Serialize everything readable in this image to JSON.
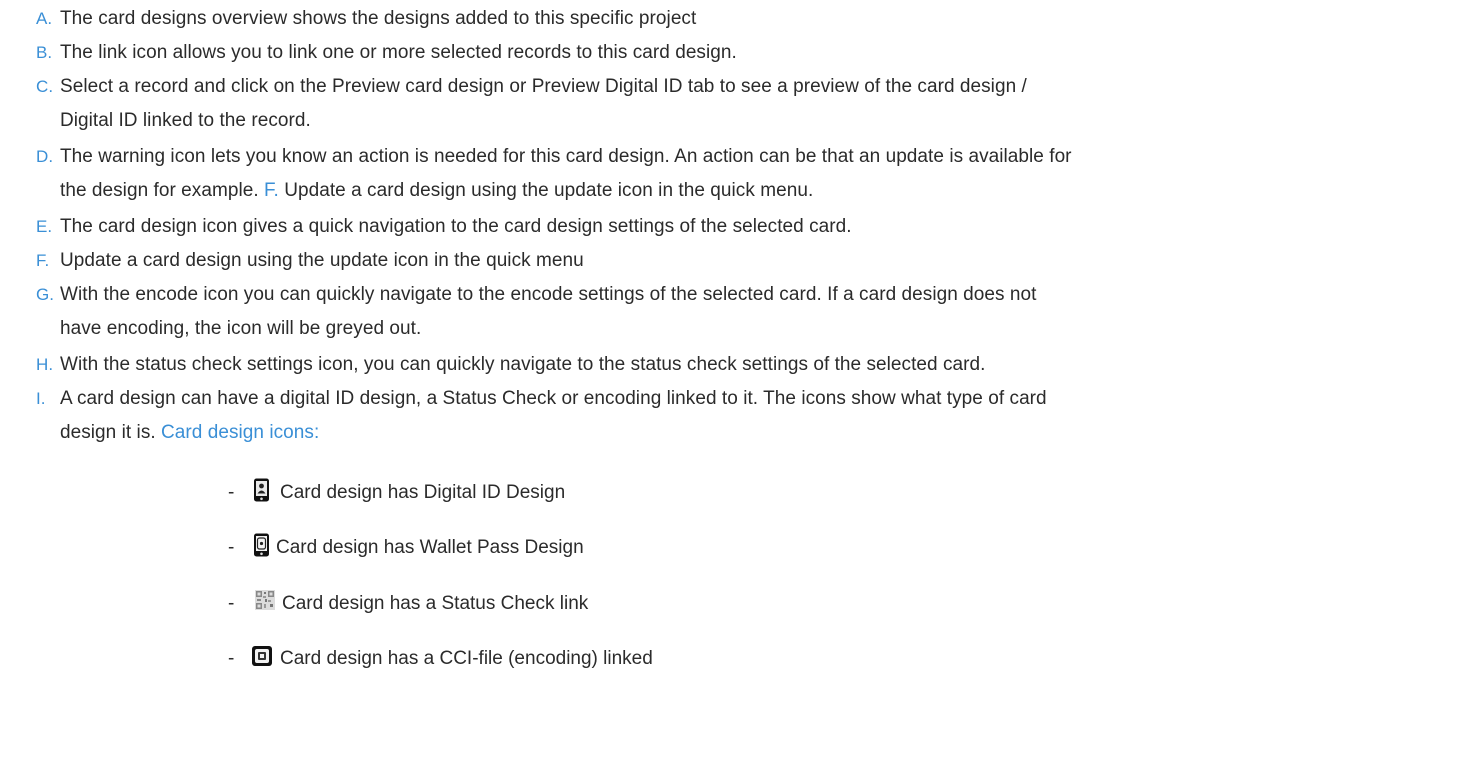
{
  "items": [
    {
      "letter": "A.",
      "text": "The card designs overview shows the designs added to this specific project"
    },
    {
      "letter": "B.",
      "text": "The link icon allows you to link one or more selected records to this card design."
    },
    {
      "letter": "C.",
      "line1": "Select a record and click on the Preview card design or Preview Digital ID tab to see a preview of the card design /",
      "line2": "Digital ID linked to the record."
    },
    {
      "letter": "D.",
      "line1": "The warning icon lets you know an action is needed for this card design. An action can be that an update is available for",
      "line2_pre": "the design for example. ",
      "line2_accent": "F.",
      "line2_post": " Update a card design using the update icon in the quick menu."
    },
    {
      "letter": "E.",
      "text": "The card design icon gives a quick navigation to the card design settings of the selected card."
    },
    {
      "letter": "F.",
      "text": "Update a card design using the update icon in the quick menu"
    },
    {
      "letter": "G.",
      "line1": "With the encode icon you can quickly navigate to the encode settings of the selected card. If a card design does not",
      "line2": "have encoding, the icon will be greyed out."
    },
    {
      "letter": "H.",
      "text": "With the status check settings icon, you can quickly navigate to the status check settings of the selected card."
    },
    {
      "letter": "I.",
      "line1": "A card design can have a digital ID design, a Status Check or encoding linked to it. The icons show what type of card",
      "line2_pre": "design it is. ",
      "line2_accent": "Card design icons:"
    }
  ],
  "bullets": [
    {
      "dash": "-",
      "icon": "phone-person-icon",
      "text": "Card design has Digital ID Design"
    },
    {
      "dash": "-",
      "icon": "phone-wallet-icon",
      "text": "Card design has Wallet Pass Design"
    },
    {
      "dash": "-",
      "icon": "qr-code-icon",
      "text": "Card design has a Status Check link"
    },
    {
      "dash": "-",
      "icon": "chip-card-icon",
      "text": "Card design has a CCI-file (encoding) linked"
    }
  ],
  "colors": {
    "accent": "#3a8fd6",
    "text": "#2b2b2b"
  }
}
